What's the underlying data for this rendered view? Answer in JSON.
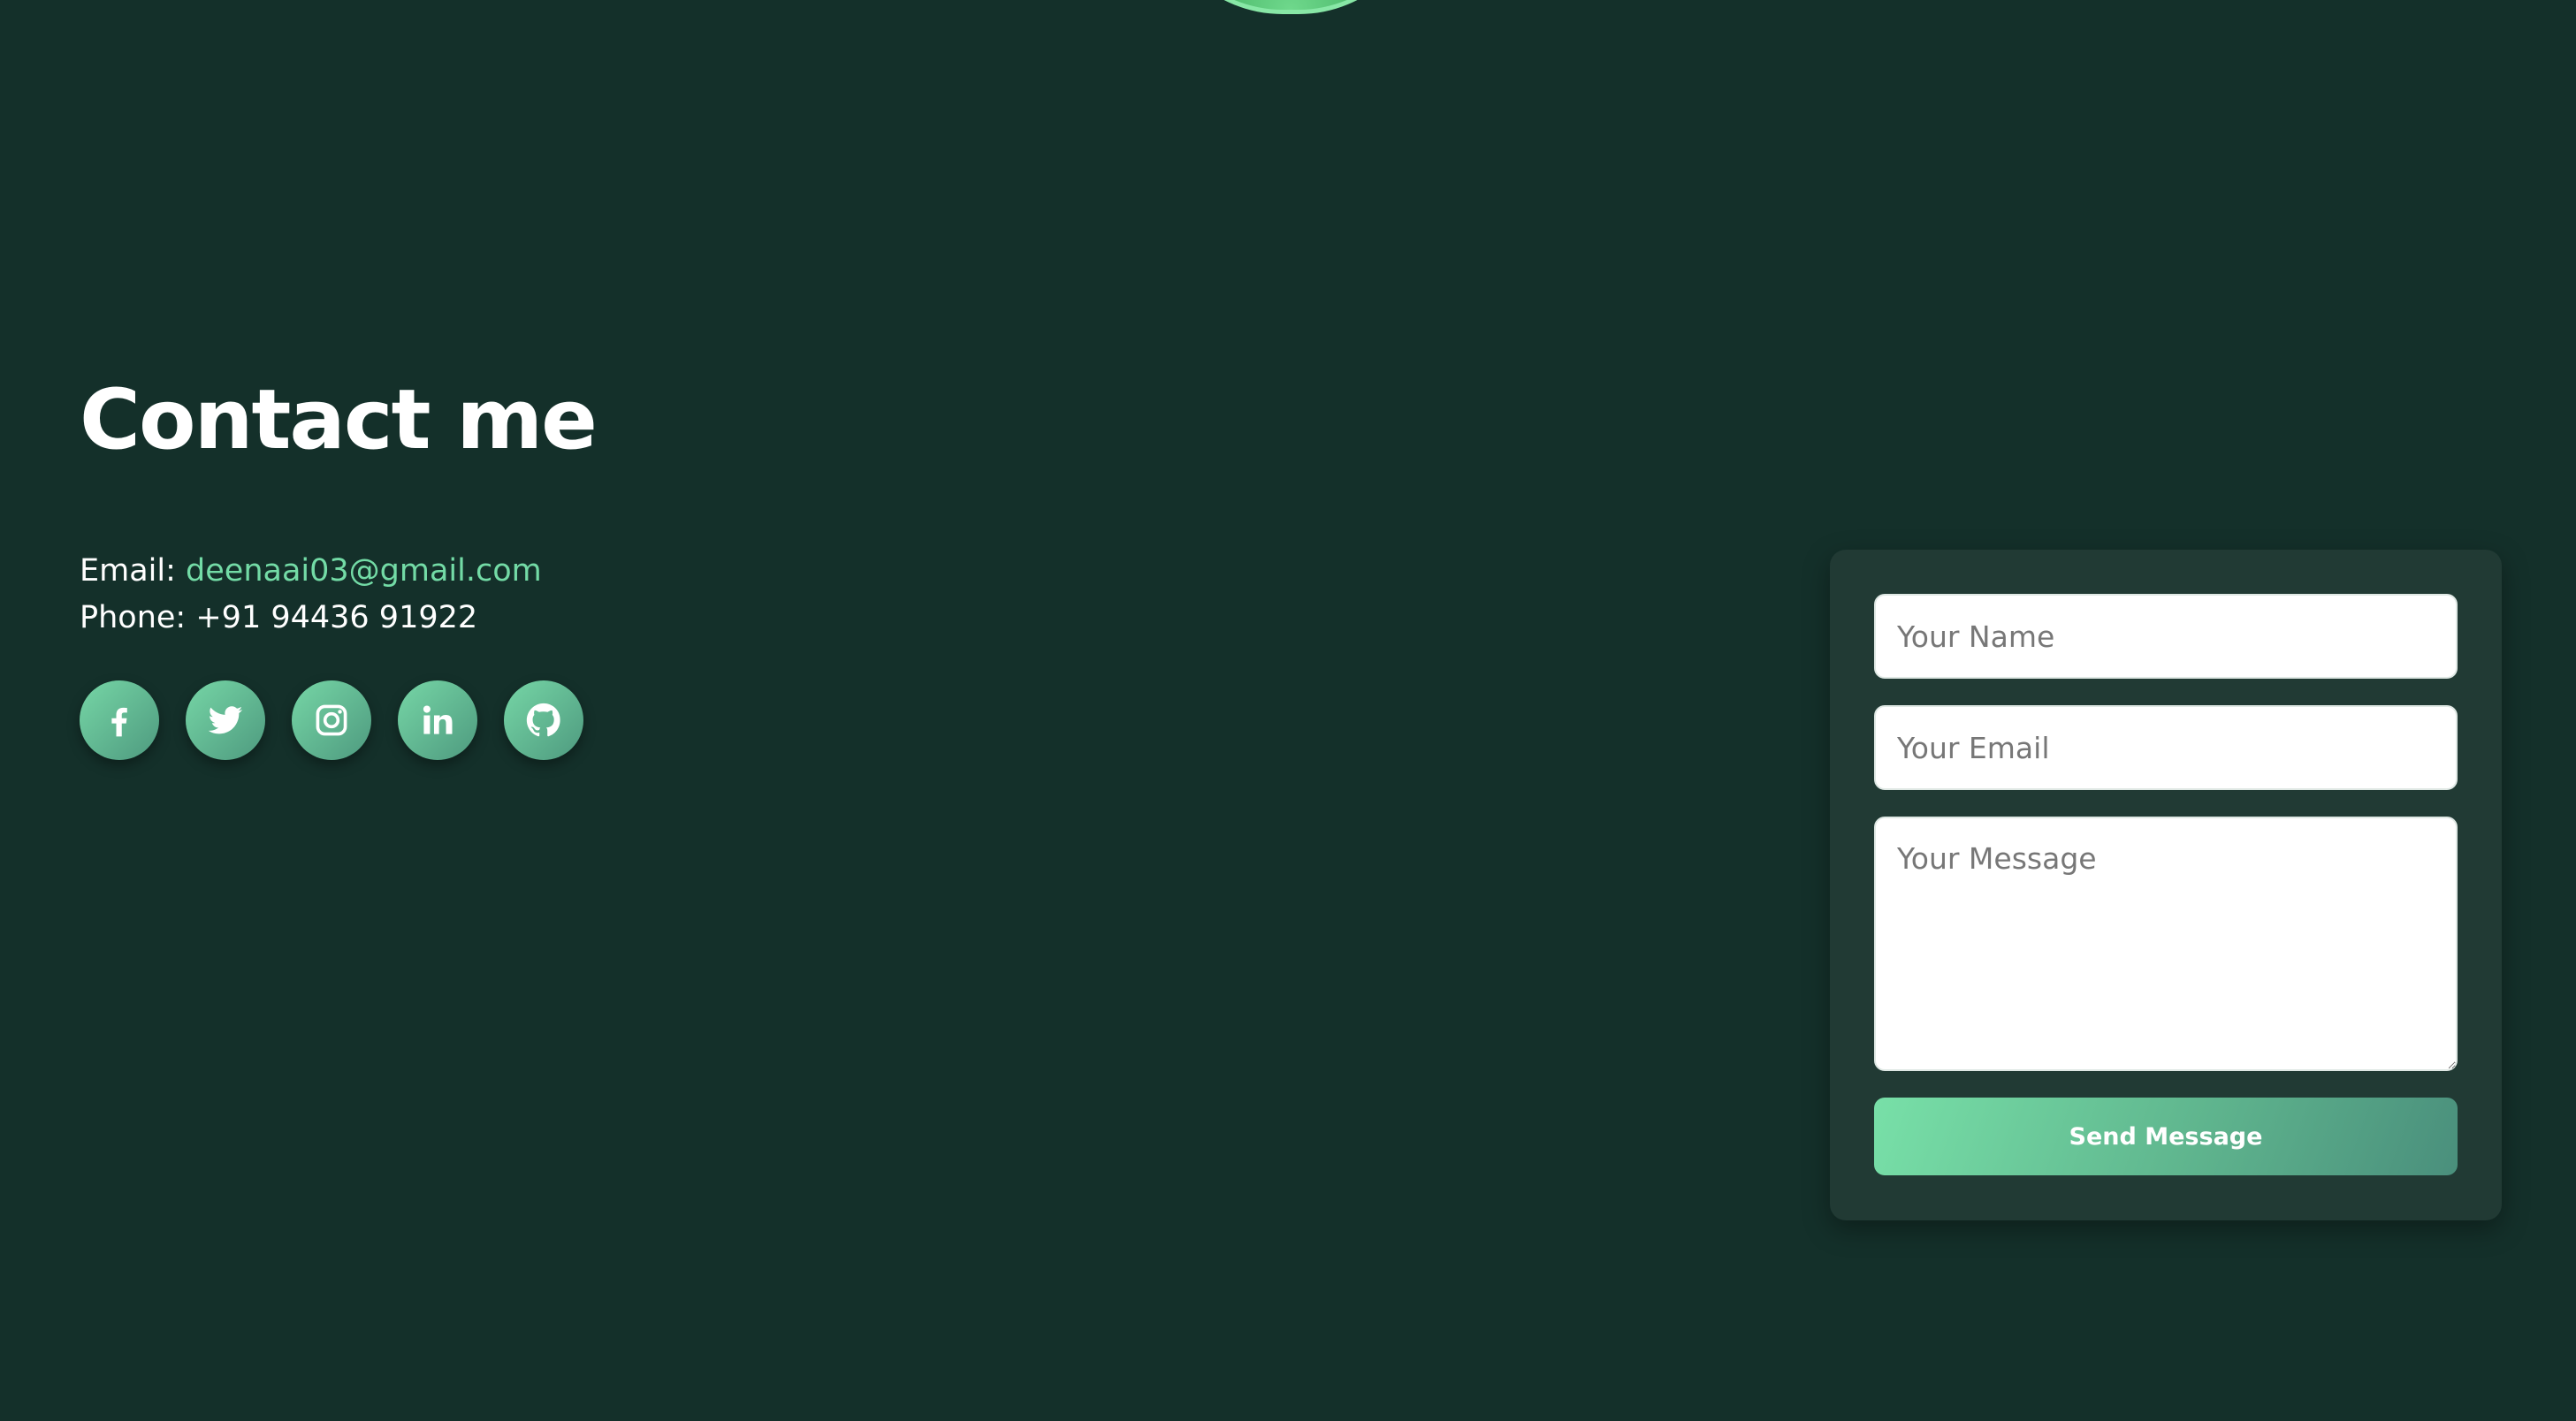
{
  "contact": {
    "title": "Contact me",
    "email_label": "Email: ",
    "email_value": "deenaai03@gmail.com",
    "phone_label": "Phone: ",
    "phone_value": "+91 94436 91922"
  },
  "socials": [
    {
      "icon": "facebook-icon"
    },
    {
      "icon": "twitter-icon"
    },
    {
      "icon": "instagram-icon"
    },
    {
      "icon": "linkedin-icon"
    },
    {
      "icon": "github-icon"
    }
  ],
  "form": {
    "name_placeholder": "Your Name",
    "email_placeholder": "Your Email",
    "message_placeholder": "Your Message",
    "submit_label": "Send Message"
  },
  "colors": {
    "background": "#14302a",
    "card": "#213a34",
    "accent": "#73dba6"
  }
}
